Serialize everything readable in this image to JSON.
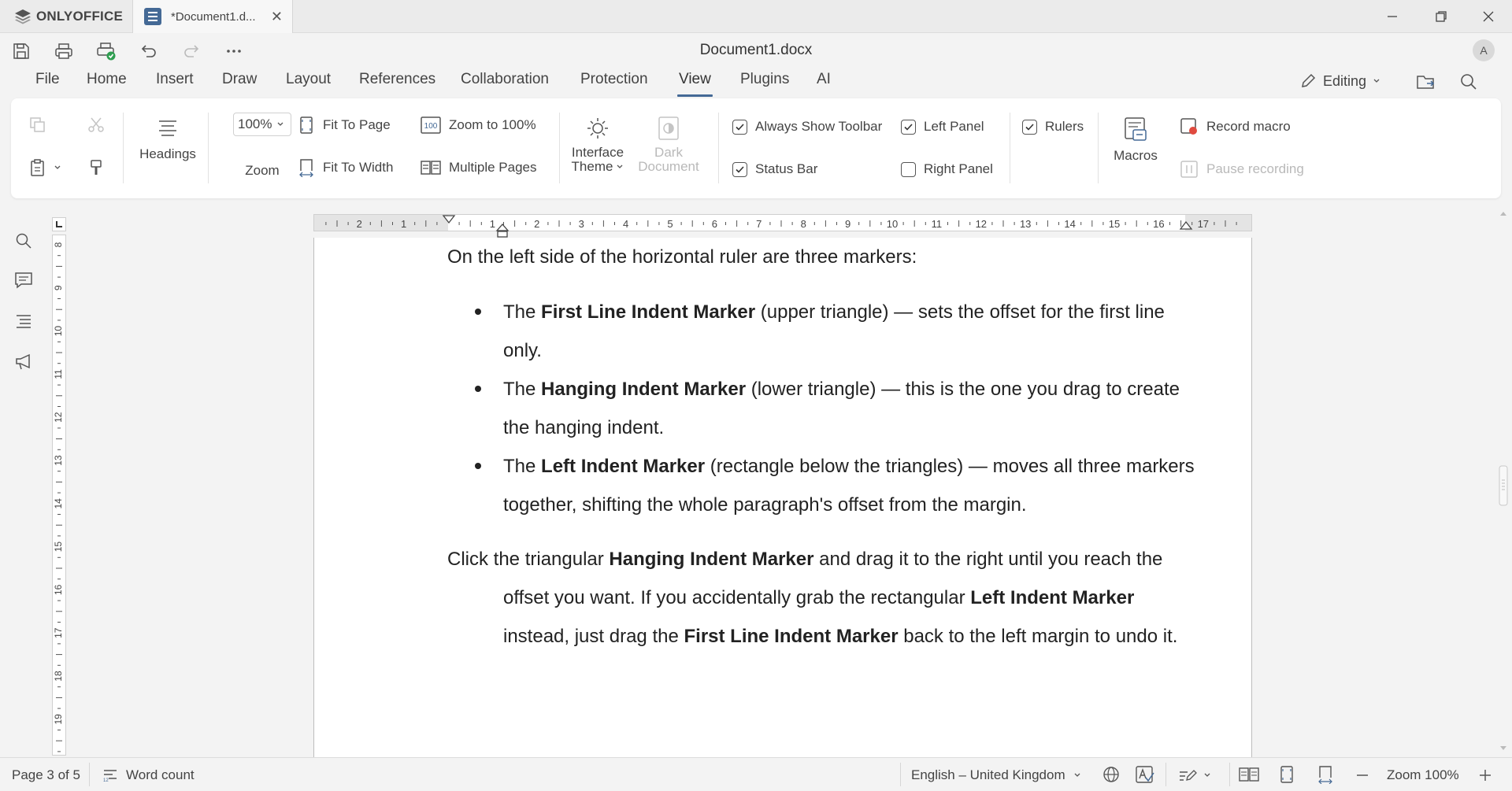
{
  "app": {
    "brand": "ONLYOFFICE",
    "tab_title": "*Document1.d...",
    "doc_title": "Document1.docx",
    "user_initial": "A"
  },
  "menu": {
    "items": [
      "File",
      "Home",
      "Insert",
      "Draw",
      "Layout",
      "References",
      "Collaboration",
      "Protection",
      "View",
      "Plugins",
      "AI"
    ],
    "active": "View",
    "editing": "Editing"
  },
  "toolbar": {
    "headings": "Headings",
    "zoom_value": "100%",
    "zoom_label": "Zoom",
    "fit_to_page": "Fit To Page",
    "fit_to_width": "Fit To Width",
    "zoom_to_100": "Zoom to 100%",
    "multiple_pages": "Multiple Pages",
    "interface_theme_1": "Interface",
    "interface_theme_2": "Theme",
    "dark_document_1": "Dark",
    "dark_document_2": "Document",
    "always_show_toolbar": "Always Show Toolbar",
    "status_bar": "Status Bar",
    "left_panel": "Left Panel",
    "right_panel": "Right Panel",
    "rulers": "Rulers",
    "macros": "Macros",
    "record_macro": "Record macro",
    "pause_recording": "Pause recording",
    "checks": {
      "always_show_toolbar": true,
      "status_bar": true,
      "left_panel": true,
      "right_panel": false,
      "rulers": true
    }
  },
  "document": {
    "intro": "On the left side of the horizontal ruler are three markers:",
    "bullets": [
      {
        "pre": "The ",
        "bold": "First Line Indent Marker",
        "post": " (upper triangle) — sets the offset for the first line only."
      },
      {
        "pre": "The ",
        "bold": "Hanging Indent Marker",
        "post": " (lower triangle) — this is the one you drag to create the hanging indent."
      },
      {
        "pre": "The ",
        "bold": "Left Indent Marker",
        "post": " (rectangle below the triangles) — moves all three markers together, shifting the whole paragraph's offset from the margin."
      }
    ],
    "click_para": {
      "t1": "Click the triangular ",
      "b1": "Hanging Indent Marker",
      "t2": " and drag it to the right until you reach the offset you want. If you accidentally grab the rectangular ",
      "b2": "Left Indent Marker",
      "t3": " instead, just drag the ",
      "b3": "First Line Indent Marker",
      "t4": " back to the left margin to undo it."
    }
  },
  "rulers": {
    "h_left_numbers": [
      "2",
      "1"
    ],
    "h_numbers": [
      "1",
      "2",
      "3",
      "4",
      "5",
      "6",
      "7",
      "8",
      "9",
      "10",
      "11",
      "12",
      "13",
      "14",
      "15",
      "16",
      "17"
    ],
    "v_numbers": [
      "8",
      "9",
      "10",
      "11",
      "12",
      "13",
      "14",
      "15",
      "16",
      "17",
      "18",
      "19"
    ]
  },
  "status": {
    "page": "Page 3 of 5",
    "word_count": "Word count",
    "language": "English – United Kingdom",
    "zoom": "Zoom 100%"
  }
}
